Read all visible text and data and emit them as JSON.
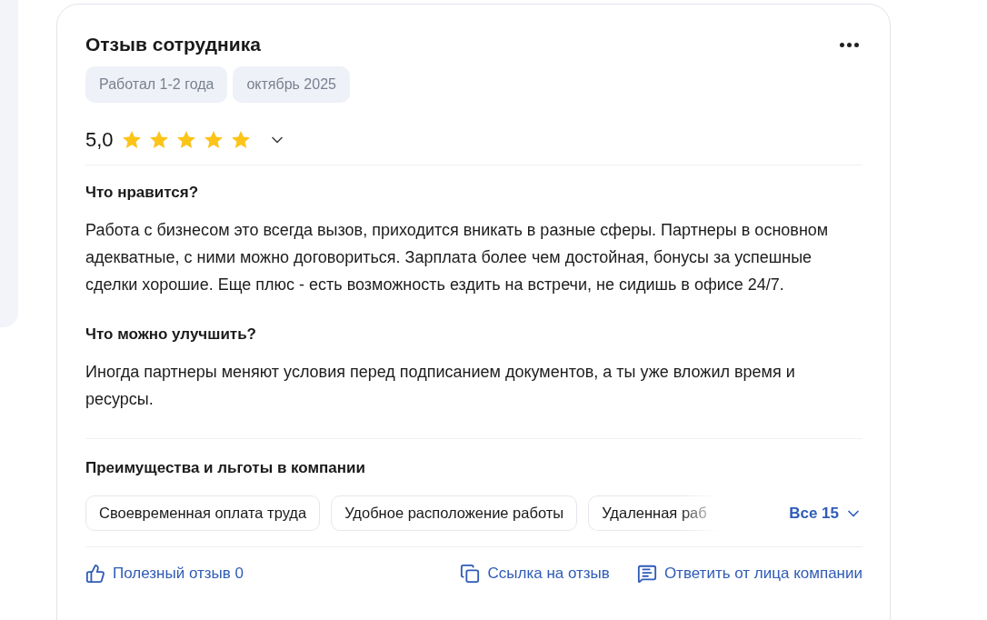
{
  "review": {
    "title": "Отзыв сотрудника",
    "tags": [
      "Работал 1-2 года",
      "октябрь 2025"
    ],
    "rating": {
      "value": "5,0",
      "stars": 5
    },
    "sections": [
      {
        "heading": "Что нравится?",
        "text": "Работа с бизнесом это всегда вызов, приходится вникать в разные сферы. Партнеры в основном адекватные, с ними можно договориться. Зарплата более чем достойная, бонусы за успешные сделки хорошие. Еще плюс - есть возможность ездить на встречи, не сидишь в офисе 24/7."
      },
      {
        "heading": "Что можно улучшить?",
        "text": "Иногда партнеры меняют условия перед подписанием документов, а ты уже вложил время и ресурсы."
      }
    ],
    "benefits": {
      "heading": "Преимущества и льготы в компании",
      "items": [
        "Своевременная оплата труда",
        "Удобное расположение работы",
        "Удаленная раб"
      ],
      "more": "Все 15"
    },
    "actions": [
      {
        "kind": "like",
        "label": "Полезный отзыв 0"
      },
      {
        "kind": "link",
        "label": "Ссылка на отзыв"
      },
      {
        "kind": "reply",
        "label": "Ответить от лица компании"
      }
    ]
  }
}
